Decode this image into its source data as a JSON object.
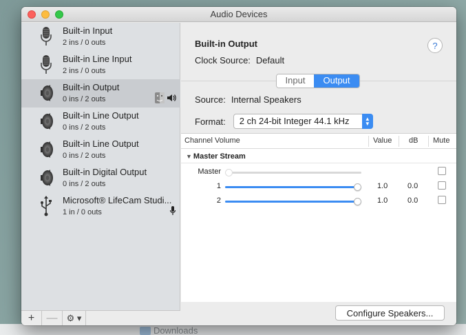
{
  "window": {
    "title": "Audio Devices"
  },
  "desktop": {
    "downloads_label": "Downloads"
  },
  "devices": [
    {
      "name": "Built-in Input",
      "io": "2 ins / 0 outs",
      "icon": "microphone-icon",
      "selected": false
    },
    {
      "name": "Built-in Line Input",
      "io": "2 ins / 0 outs",
      "icon": "microphone-icon",
      "selected": false
    },
    {
      "name": "Built-in Output",
      "io": "0 ins / 2 outs",
      "icon": "speaker-icon",
      "selected": true,
      "badges": [
        "finder-icon",
        "speaker-volume-icon"
      ]
    },
    {
      "name": "Built-in Line Output",
      "io": "0 ins / 2 outs",
      "icon": "speaker-icon",
      "selected": false
    },
    {
      "name": "Built-in Line Output",
      "io": "0 ins / 2 outs",
      "icon": "speaker-icon",
      "selected": false
    },
    {
      "name": "Built-in Digital Output",
      "io": "0 ins / 2 outs",
      "icon": "speaker-icon",
      "selected": false
    },
    {
      "name": "Microsoft® LifeCam Studi...",
      "io": "1 in / 0 outs",
      "icon": "usb-icon",
      "selected": false,
      "badges": [
        "microphone-small-icon"
      ]
    }
  ],
  "sidebar_toolbar": {
    "add": "+",
    "remove": "—",
    "gear": "⚙ ▾"
  },
  "detail": {
    "title": "Built-in Output",
    "help": "?",
    "clock_label": "Clock Source:",
    "clock_value": "Default",
    "tabs": [
      "Input",
      "Output"
    ],
    "active_tab": "Output",
    "source_label": "Source:",
    "source_value": "Internal Speakers",
    "format_label": "Format:",
    "format_value": "2 ch 24-bit Integer 44.1 kHz"
  },
  "volume_table": {
    "headers": {
      "channel": "Channel Volume",
      "value": "Value",
      "db": "dB",
      "mute": "Mute"
    },
    "stream": "Master Stream",
    "rows": [
      {
        "label": "Master",
        "value": "",
        "db": "",
        "level": 0.0,
        "enabled": false
      },
      {
        "label": "1",
        "value": "1.0",
        "db": "0.0",
        "level": 1.0,
        "enabled": true
      },
      {
        "label": "2",
        "value": "1.0",
        "db": "0.0",
        "level": 1.0,
        "enabled": true
      }
    ]
  },
  "configure_button": "Configure Speakers...",
  "colors": {
    "accent": "#3b8cf2",
    "sidebar": "#dde0e3",
    "selected": "#c9ccd0"
  }
}
